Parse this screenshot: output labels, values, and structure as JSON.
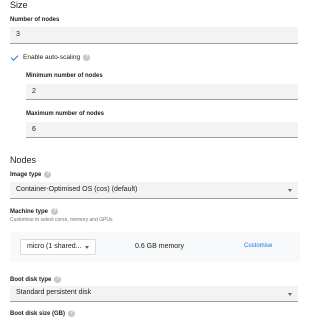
{
  "size_section": {
    "title": "Size",
    "number_of_nodes_label": "Number of nodes",
    "number_of_nodes_value": "3",
    "autoscaling_label": "Enable auto-scaling",
    "autoscaling_checked": true,
    "min_nodes_label": "Minimum number of nodes",
    "min_nodes_value": "2",
    "max_nodes_label": "Maximum number of nodes",
    "max_nodes_value": "6"
  },
  "nodes_section": {
    "title": "Nodes",
    "image_type_label": "Image type",
    "image_type_value": "Container-Optimised OS (cos) (default)",
    "machine_type_label": "Machine type",
    "machine_type_hint": "Customise to select cores, memory and GPUs",
    "machine_type_value": "micro (1 shared...",
    "machine_memory": "0.6 GB memory",
    "customise_label": "Customise",
    "boot_disk_type_label": "Boot disk type",
    "boot_disk_type_value": "Standard persistent disk",
    "boot_disk_size_label": "Boot disk size (GB)"
  },
  "colors": {
    "accent": "#1a73e8",
    "field_bg": "#f1f3f4",
    "help_icon": "#c7c7c7"
  }
}
